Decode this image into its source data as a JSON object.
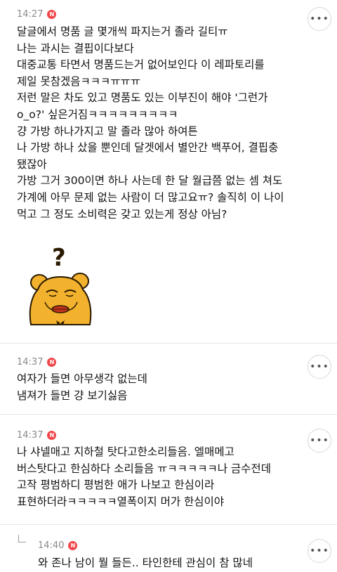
{
  "comments": [
    {
      "time": "14:27",
      "badge": "N",
      "more": "•••",
      "text": "달글에서 명품 글 몇개씩 파지는거 졸라 길티ㅠ\n나는 과시는 결핍이다보다\n대중교통 타면서 명품드는거 없어보인다 이 레파토리를\n제일 못참겠음ㅋㅋㅋㅠㅠㅠ\n저런 말은 차도 있고 명품도 있는 이부진이 해야 '그런가\no_o?' 싶은거짐ㅋㅋㅋㅋㅋㅋㅋㅋㅋ\n걍 가방 하나가지고 말 졸라 많아 하여튼\n나 가방 하나 샀을 뿐인데 달겟에서 별안간 백푸어, 결핍충\n됐잖아\n가방 그거 300이면 하나 사는데 한 달 월급쯤 없는 셈 쳐도\n가계에 아무 문제 없는 사람이 더 많고요ㅠ? 솔직히 이 나이\n먹고 그 정도 소비력은 갖고 있는게 정상 아님?",
      "sticker": "question-bear-sticker",
      "sticker_mark": "?"
    },
    {
      "time": "14:37",
      "badge": "N",
      "more": "•••",
      "text": "여자가 들면 아무생각 없는데\n냄져가 들면 걍 보기싫음"
    },
    {
      "time": "14:37",
      "badge": "N",
      "more": "•••",
      "text": "나 샤넬매고 지하철 탓다고한소리들음. 엘매메고\n버스탓다고 한심하다 소리들음 ㅠㅋㅋㅋㅋㅋ나 금수전데\n고작 평범하디 평범한 애가 나보고 한심이라\n표현하더라ㅋㅋㅋㅋㅋ열폭이지 머가 한심이야"
    },
    {
      "time": "14:40",
      "badge": "N",
      "more": "•••",
      "text": "와 존나 남이 뭘 들든.. 타인한테 관심이 참 많네",
      "is_reply": true
    }
  ],
  "colors": {
    "badge": "#f0474b",
    "time": "#8a8a8a",
    "bear": "#f2b22e",
    "bear_outline": "#2a1a00",
    "lips": "#c8321e"
  }
}
